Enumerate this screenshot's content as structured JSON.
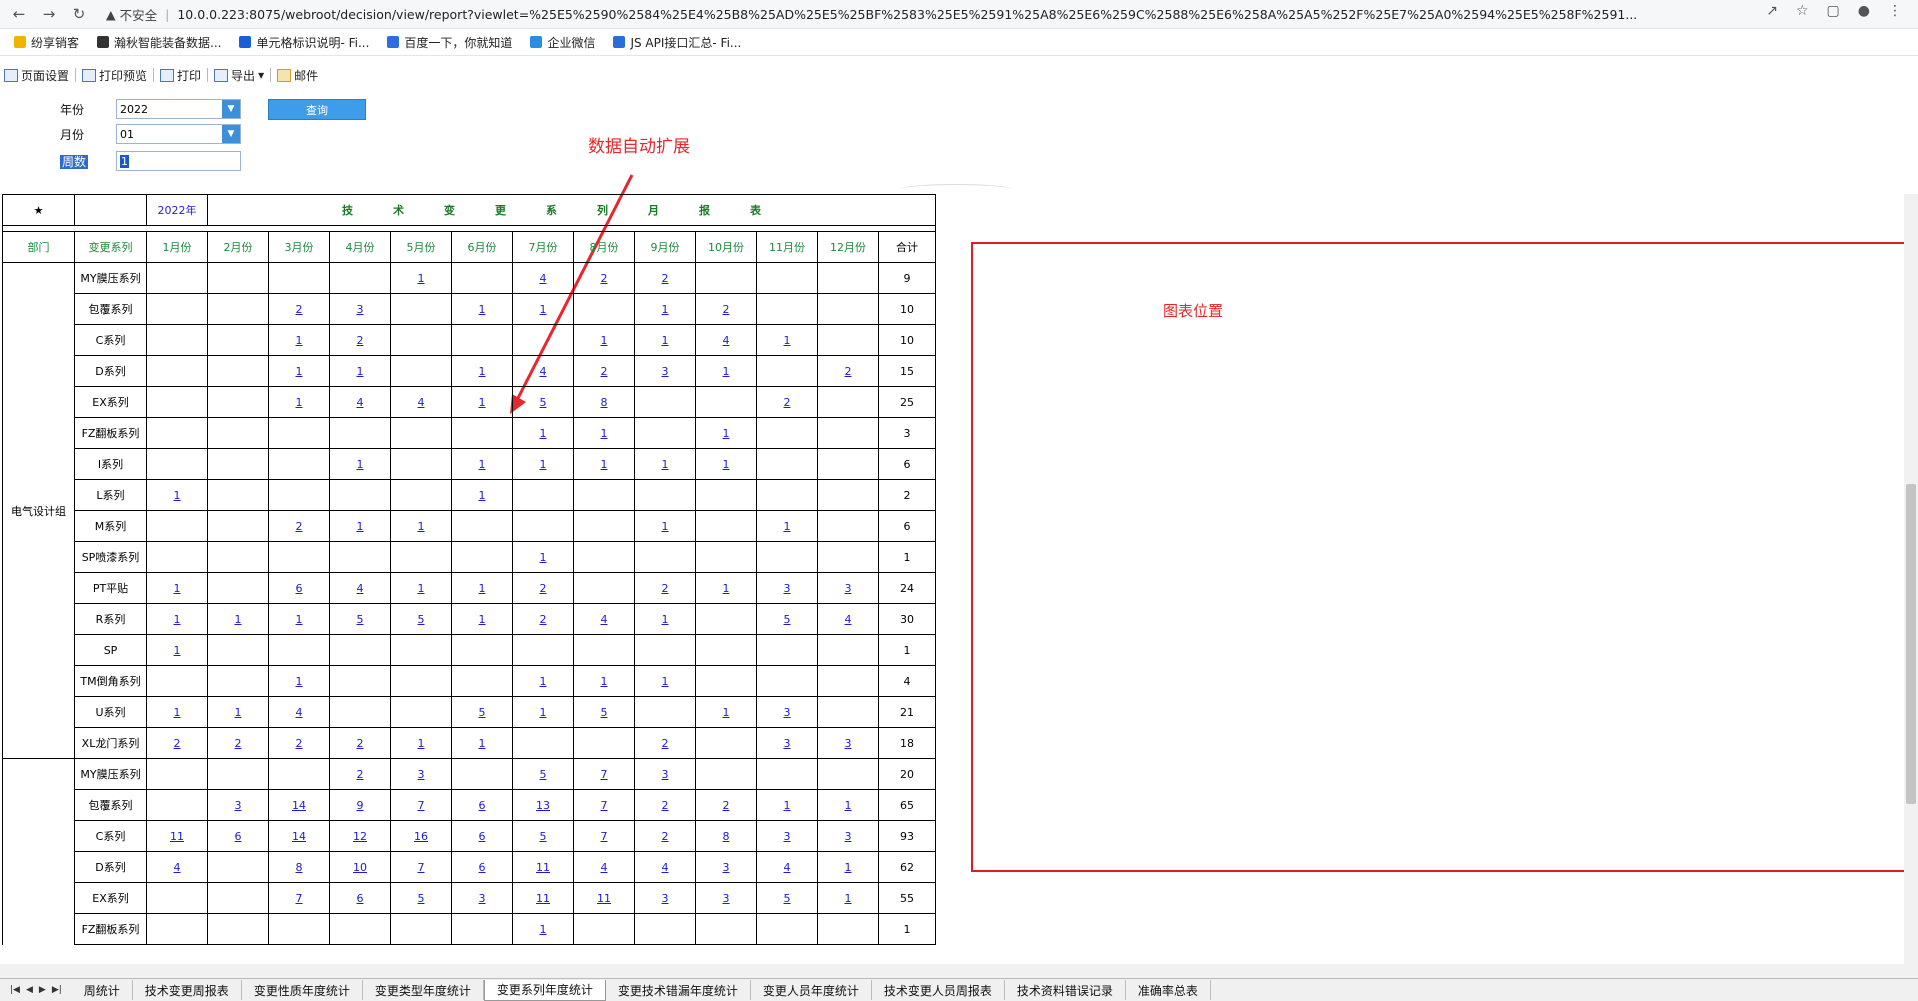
{
  "browser": {
    "security_label": "不安全",
    "url": "10.0.0.223:8075/webroot/decision/view/report?viewlet=%25E5%2590%2584%25E4%25B8%25AD%25E5%25BF%2583%25E5%2591%25A8%25E6%259C%2588%25E6%258A%25A5%252F%25E7%25A0%2594%25E5%258F%2591..."
  },
  "bookmarks": [
    "纷享销客",
    "瀚秋智能装备数据...",
    "单元格标识说明- Fi...",
    "百度一下，你就知道",
    "企业微信",
    "JS API接口汇总- Fi..."
  ],
  "toolbar": {
    "page_setup": "页面设置",
    "print_preview": "打印预览",
    "print": "打印",
    "export": "导出",
    "mail": "邮件"
  },
  "params": {
    "year_label": "年份",
    "year_value": "2022",
    "month_label": "月份",
    "month_value": "01",
    "week_label": "周数",
    "week_value": "1",
    "query_button": "查询"
  },
  "annotation": "数据自动扩展",
  "chart_placeholder": "图表位置",
  "report": {
    "star": "★",
    "year_cell": "2022年",
    "title": "技术变更系列月报表",
    "headers": [
      "部门",
      "变更系列",
      "1月份",
      "2月份",
      "3月份",
      "4月份",
      "5月份",
      "6月份",
      "7月份",
      "8月份",
      "9月份",
      "10月份",
      "11月份",
      "12月份",
      "合计"
    ],
    "groups": [
      {
        "dept": "电气设计组",
        "rows": [
          {
            "name": "MY膜压系列",
            "vals": [
              "",
              "",
              "",
              "",
              "1",
              "",
              "4",
              "2",
              "2",
              "",
              "",
              ""
            ],
            "total": "9"
          },
          {
            "name": "包覆系列",
            "vals": [
              "",
              "",
              "2",
              "3",
              "",
              "1",
              "1",
              "",
              "1",
              "2",
              "",
              ""
            ],
            "total": "10"
          },
          {
            "name": "C系列",
            "vals": [
              "",
              "",
              "1",
              "2",
              "",
              "",
              "",
              "1",
              "1",
              "4",
              "1",
              ""
            ],
            "total": "10"
          },
          {
            "name": "D系列",
            "vals": [
              "",
              "",
              "1",
              "1",
              "",
              "1",
              "4",
              "2",
              "3",
              "1",
              "",
              "2"
            ],
            "total": "15"
          },
          {
            "name": "EX系列",
            "vals": [
              "",
              "",
              "1",
              "4",
              "4",
              "1",
              "5",
              "8",
              "",
              "",
              "2",
              ""
            ],
            "total": "25"
          },
          {
            "name": "FZ翻板系列",
            "vals": [
              "",
              "",
              "",
              "",
              "",
              "",
              "1",
              "1",
              "",
              "1",
              "",
              ""
            ],
            "total": "3"
          },
          {
            "name": "I系列",
            "vals": [
              "",
              "",
              "",
              "1",
              "",
              "1",
              "1",
              "1",
              "1",
              "1",
              "",
              ""
            ],
            "total": "6"
          },
          {
            "name": "L系列",
            "vals": [
              "1",
              "",
              "",
              "",
              "",
              "1",
              "",
              "",
              "",
              "",
              "",
              ""
            ],
            "total": "2"
          },
          {
            "name": "M系列",
            "vals": [
              "",
              "",
              "2",
              "1",
              "1",
              "",
              "",
              "",
              "1",
              "",
              "1",
              ""
            ],
            "total": "6"
          },
          {
            "name": "SP喷漆系列",
            "vals": [
              "",
              "",
              "",
              "",
              "",
              "",
              "1",
              "",
              "",
              "",
              "",
              ""
            ],
            "total": "1"
          },
          {
            "name": "PT平贴",
            "vals": [
              "1",
              "",
              "6",
              "4",
              "1",
              "1",
              "2",
              "",
              "2",
              "1",
              "3",
              "3"
            ],
            "total": "24"
          },
          {
            "name": "R系列",
            "vals": [
              "1",
              "1",
              "1",
              "5",
              "5",
              "1",
              "2",
              "4",
              "1",
              "",
              "5",
              "4"
            ],
            "total": "30"
          },
          {
            "name": "SP",
            "vals": [
              "1",
              "",
              "",
              "",
              "",
              "",
              "",
              "",
              "",
              "",
              "",
              ""
            ],
            "total": "1"
          },
          {
            "name": "TM倒角系列",
            "vals": [
              "",
              "",
              "1",
              "",
              "",
              "",
              "1",
              "1",
              "1",
              "",
              "",
              ""
            ],
            "total": "4"
          },
          {
            "name": "U系列",
            "vals": [
              "1",
              "1",
              "4",
              "",
              "",
              "5",
              "1",
              "5",
              "",
              "1",
              "3",
              ""
            ],
            "total": "21"
          },
          {
            "name": "XL龙门系列",
            "vals": [
              "2",
              "2",
              "2",
              "2",
              "1",
              "1",
              "",
              "",
              "2",
              "",
              "3",
              "3"
            ],
            "total": "18"
          }
        ]
      },
      {
        "dept": "",
        "rows": [
          {
            "name": "MY膜压系列",
            "vals": [
              "",
              "",
              "",
              "2",
              "3",
              "",
              "5",
              "7",
              "3",
              "",
              "",
              ""
            ],
            "total": "20"
          },
          {
            "name": "包覆系列",
            "vals": [
              "",
              "3",
              "14",
              "9",
              "7",
              "6",
              "13",
              "7",
              "2",
              "2",
              "1",
              "1"
            ],
            "total": "65"
          },
          {
            "name": "C系列",
            "vals": [
              "11",
              "6",
              "14",
              "12",
              "16",
              "6",
              "5",
              "7",
              "2",
              "8",
              "3",
              "3"
            ],
            "total": "93"
          },
          {
            "name": "D系列",
            "vals": [
              "4",
              "",
              "8",
              "10",
              "7",
              "6",
              "11",
              "4",
              "4",
              "3",
              "4",
              "1"
            ],
            "total": "62"
          },
          {
            "name": "EX系列",
            "vals": [
              "",
              "",
              "7",
              "6",
              "5",
              "3",
              "11",
              "11",
              "3",
              "3",
              "5",
              "1"
            ],
            "total": "55"
          },
          {
            "name": "FZ翻板系列",
            "vals": [
              "",
              "",
              "",
              "",
              "",
              "",
              "1",
              "",
              "",
              "",
              "",
              ""
            ],
            "total": "1"
          }
        ]
      }
    ]
  },
  "sheet_tabs": [
    "周统计",
    "技术变更周报表",
    "变更性质年度统计",
    "变更类型年度统计",
    "变更系列年度统计",
    "变更技术错漏年度统计",
    "变更人员年度统计",
    "技术变更人员周报表",
    "技术资料错误记录",
    "准确率总表"
  ],
  "colors": {
    "title_green": "#1a7a26",
    "header_green": "#1a8a3a",
    "link_blue": "#1a1ad8",
    "annotation_red": "#e8262b",
    "query_blue": "#3d9de8"
  }
}
